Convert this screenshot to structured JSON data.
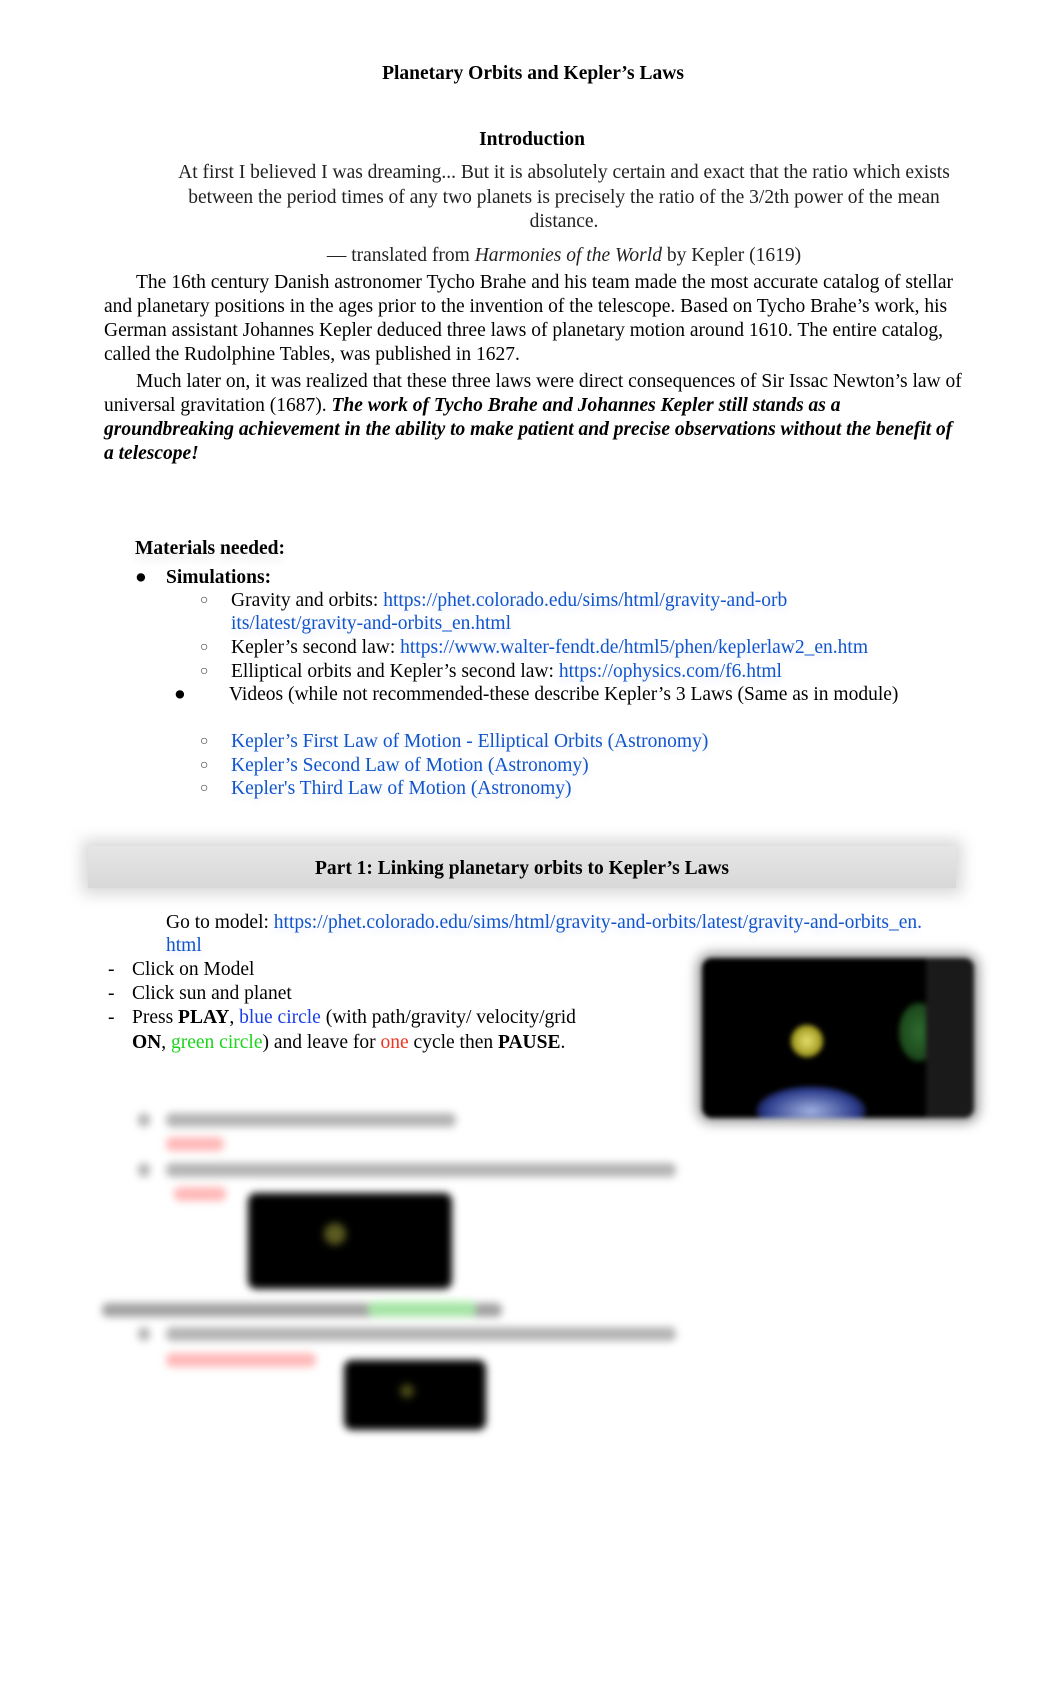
{
  "document": {
    "title": "Planetary Orbits and Kepler’s Laws",
    "introduction_heading": "Introduction",
    "quote": "At first I believed I was dreaming... But it is absolutely certain and exact that the ratio which exists between the period times of any two planets is precisely the ratio of the 3/2th power of the mean distance.",
    "attribution": {
      "prefix": "— translated from ",
      "work": "Harmonies of the World",
      "suffix": " by Kepler (1619)"
    },
    "paragraph1": "The 16th century Danish astronomer Tycho Brahe and his team made the most accurate catalog of stellar and planetary positions in the ages prior to the invention of the telescope. Based on Tycho Brahe’s work, his German assistant Johannes Kepler deduced three laws of planetary motion around 1610. The entire catalog, called the Rudolphine Tables, was published in 1627.",
    "paragraph2": {
      "plain": "Much later on, it was realized that these three laws were direct consequences of Sir Issac Newton’s law of universal gravitation (1687). ",
      "emphasis": "The work of Tycho Brahe and Johannes Kepler still stands as a groundbreaking achievement in the ability to make patient and precise observations without the benefit of a telescope!"
    },
    "materials": {
      "heading": "Materials needed:",
      "simulations_label": "Simulations:",
      "simulations": [
        {
          "label": "Gravity and orbits: ",
          "link": "https://phet.colorado.edu/sims/html/gravity-and-orbits/latest/gravity-and-orbits_en.html"
        },
        {
          "label": "Kepler’s second law: ",
          "link": "https://www.walter-fendt.de/html5/phen/keplerlaw2_en.htm"
        },
        {
          "label": "Elliptical orbits and Kepler’s second law:  ",
          "link": "https://ophysics.com/f6.html"
        }
      ],
      "videos_label": "Videos (while not recommended-these describe Kepler’s 3 Laws (Same as in module)",
      "videos": [
        "Kepler’s First Law of Motion - Elliptical Orbits  (Astronomy)",
        "Kepler’s Second Law of Motion  (Astronomy)",
        "Kepler's Third Law of Motion  (Astronomy)"
      ]
    },
    "part1": {
      "heading": "Part 1: Linking planetary orbits to Kepler’s Laws",
      "goto_label": "Go to model: ",
      "goto_link": "https://phet.colorado.edu/sims/html/gravity-and-orbits/latest/gravity-and-orbits_en.html",
      "steps": [
        {
          "text": "Click on Model"
        },
        {
          "text": "Click sun and planet"
        }
      ],
      "step3": {
        "press": "Press ",
        "play": "PLAY",
        "comma1": ", ",
        "blue_circle": "blue circle",
        "mid1": " (with path/gravity/ velocity/grid ",
        "on": "ON",
        "comma2": ", ",
        "green_circle": "green circle",
        "mid2": ") and leave for ",
        "one": "one",
        "mid3": " cycle then ",
        "pause": "PAUSE",
        "end": "."
      },
      "screenshot_icon": "simulation-screenshot"
    }
  },
  "colors": {
    "link": "#1155cc",
    "blue_circle": "#1a3de8",
    "green_circle": "#1bd41b",
    "red_one": "#f0321e",
    "part_band": "#dcdcdc"
  }
}
